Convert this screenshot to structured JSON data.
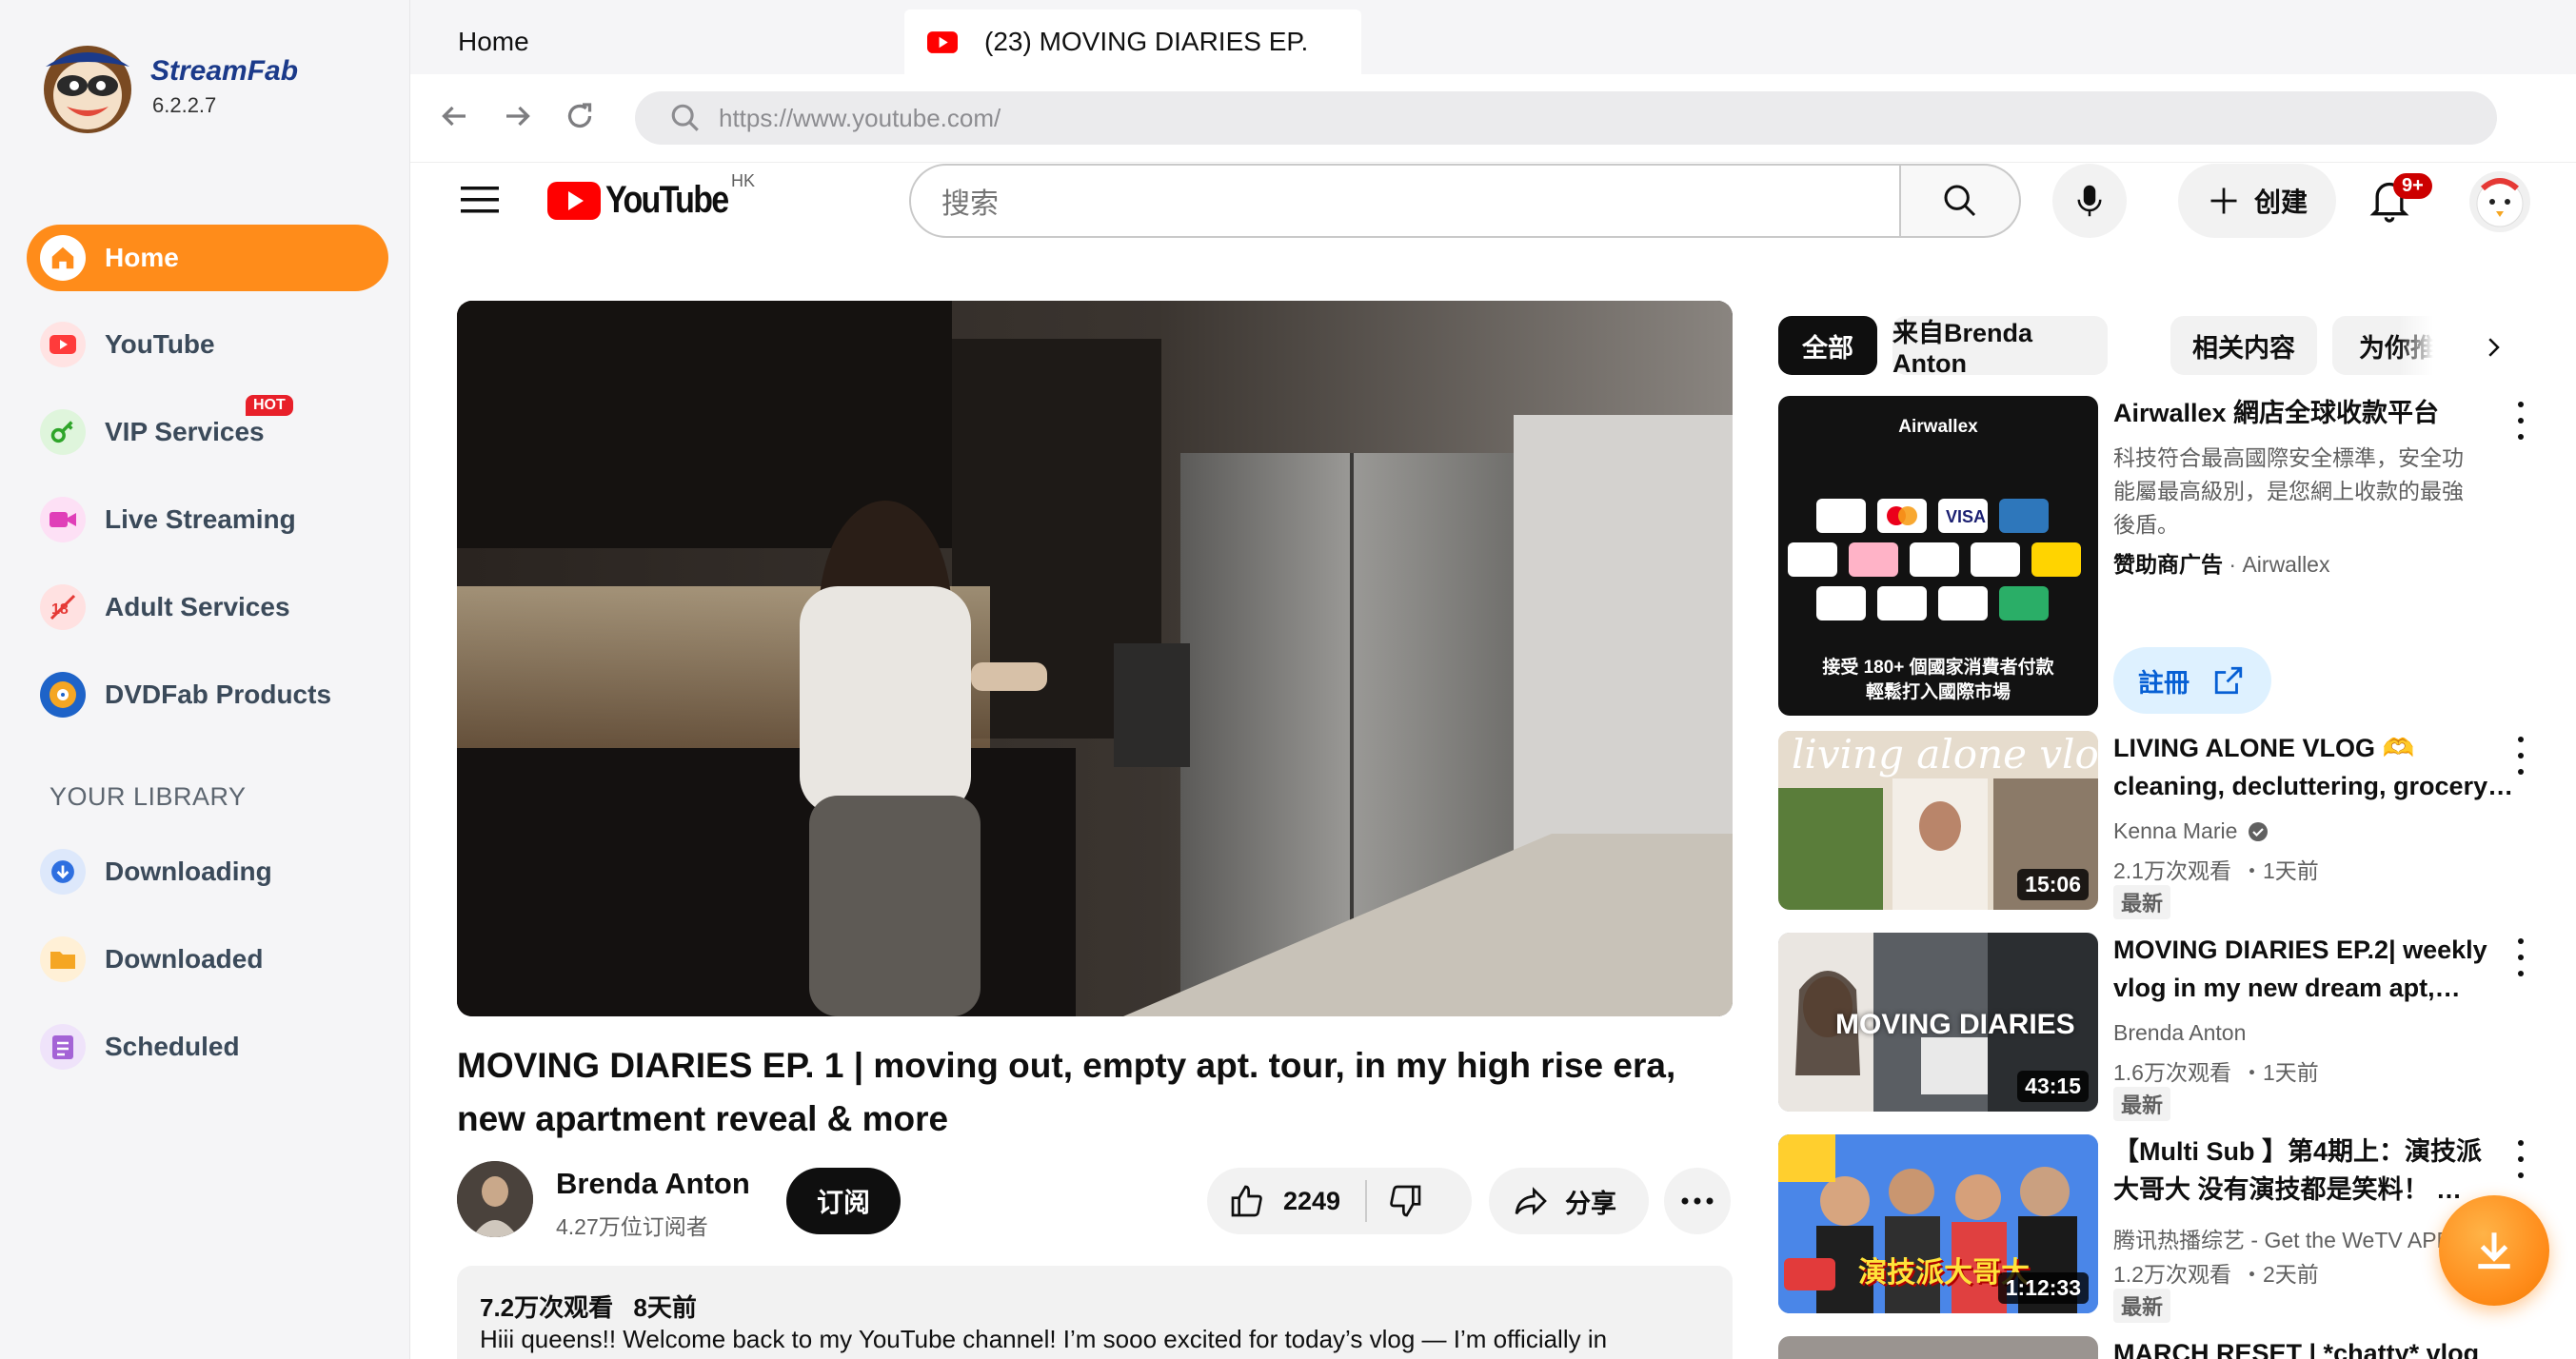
{
  "app": {
    "name": "StreamFab",
    "version": "6.2.2.7"
  },
  "sidebar": {
    "items": [
      {
        "label": "Home",
        "icon": "home-icon",
        "active": true
      },
      {
        "label": "YouTube",
        "icon": "youtube-icon"
      },
      {
        "label": "VIP Services",
        "icon": "key-icon",
        "badge": "HOT"
      },
      {
        "label": "Live Streaming",
        "icon": "camera-icon"
      },
      {
        "label": "Adult Services",
        "icon": "adult-icon"
      },
      {
        "label": "DVDFab Products",
        "icon": "dvdfab-icon"
      }
    ],
    "library_title": "YOUR LIBRARY",
    "library": [
      {
        "label": "Downloading",
        "icon": "download-arrow-icon"
      },
      {
        "label": "Downloaded",
        "icon": "folder-icon"
      },
      {
        "label": "Scheduled",
        "icon": "schedule-icon"
      }
    ]
  },
  "tabs": [
    {
      "label": "Home"
    },
    {
      "label": "(23) MOVING DIARIES EP."
    }
  ],
  "address": {
    "url": "https://www.youtube.com/"
  },
  "youtube": {
    "logo_text": "YouTube",
    "region": "HK",
    "search_placeholder": "搜索",
    "create_label": "创建",
    "notif_count": "9+"
  },
  "video": {
    "title_line1": "MOVING DIARIES EP. 1 | moving out, empty apt. tour, in my high rise era,",
    "title_line2": "new apartment reveal & more",
    "channel": "Brenda Anton",
    "subscribers": "4.27万位订阅者",
    "subscribe_label": "订阅",
    "likes": "2249",
    "share_label": "分享",
    "views": "7.2万次观看",
    "age": "8天前",
    "description": "Hiii queens!!  Welcome back to my YouTube channel! I’m sooo excited for today’s vlog — I’m officially in"
  },
  "chips": [
    "全部",
    "来自Brenda Anton",
    "相关内容",
    "为你推"
  ],
  "recommendations": [
    {
      "title_line1": "Airwallex 網店全球收款平台",
      "desc": [
        "科技符合最高國際安全標準，安全功",
        "能屬最高級別，是您網上收款的最強",
        "後盾。"
      ],
      "sponsor_label": "赞助商广告",
      "sponsor": "Airwallex",
      "cta": "註冊",
      "thumb_brand": "Airwallex",
      "thumb_caption1": "接受 180+ 個國家消費者付款",
      "thumb_caption2": "輕鬆打入國際市場"
    },
    {
      "title_line1": "LIVING ALONE VLOG 🫶",
      "title_line2": "cleaning, decluttering, grocery…",
      "channel": "Kenna Marie",
      "verified": true,
      "views": "2.1万次观看",
      "age": "・1天前",
      "badge": "最新",
      "duration": "15:06",
      "thumb_text": "living alone vlog"
    },
    {
      "title_line1": "MOVING DIARIES EP.2| weekly",
      "title_line2": "vlog in my new dream apt,…",
      "channel": "Brenda Anton",
      "views": "1.6万次观看",
      "age": "・1天前",
      "badge": "最新",
      "duration": "43:15",
      "thumb_text": "MOVING DIARIES"
    },
    {
      "title_line1": "【Multi Sub 】第4期上：演技派",
      "title_line2": "大哥大 没有演技都是笑料！ …",
      "channel": "腾讯热播综艺 - Get the WeTV APP",
      "views": "1.2万次观看",
      "age": "・2天前",
      "badge": "最新",
      "duration": "1:12:33",
      "thumb_text": "演技派大哥大"
    },
    {
      "title_line1": "MARCH RESET | *chatty* vlog"
    }
  ],
  "colors": {
    "accent": "#ff8c1a",
    "yt_red": "#ff0000",
    "brand_blue": "#1b3a8a"
  }
}
